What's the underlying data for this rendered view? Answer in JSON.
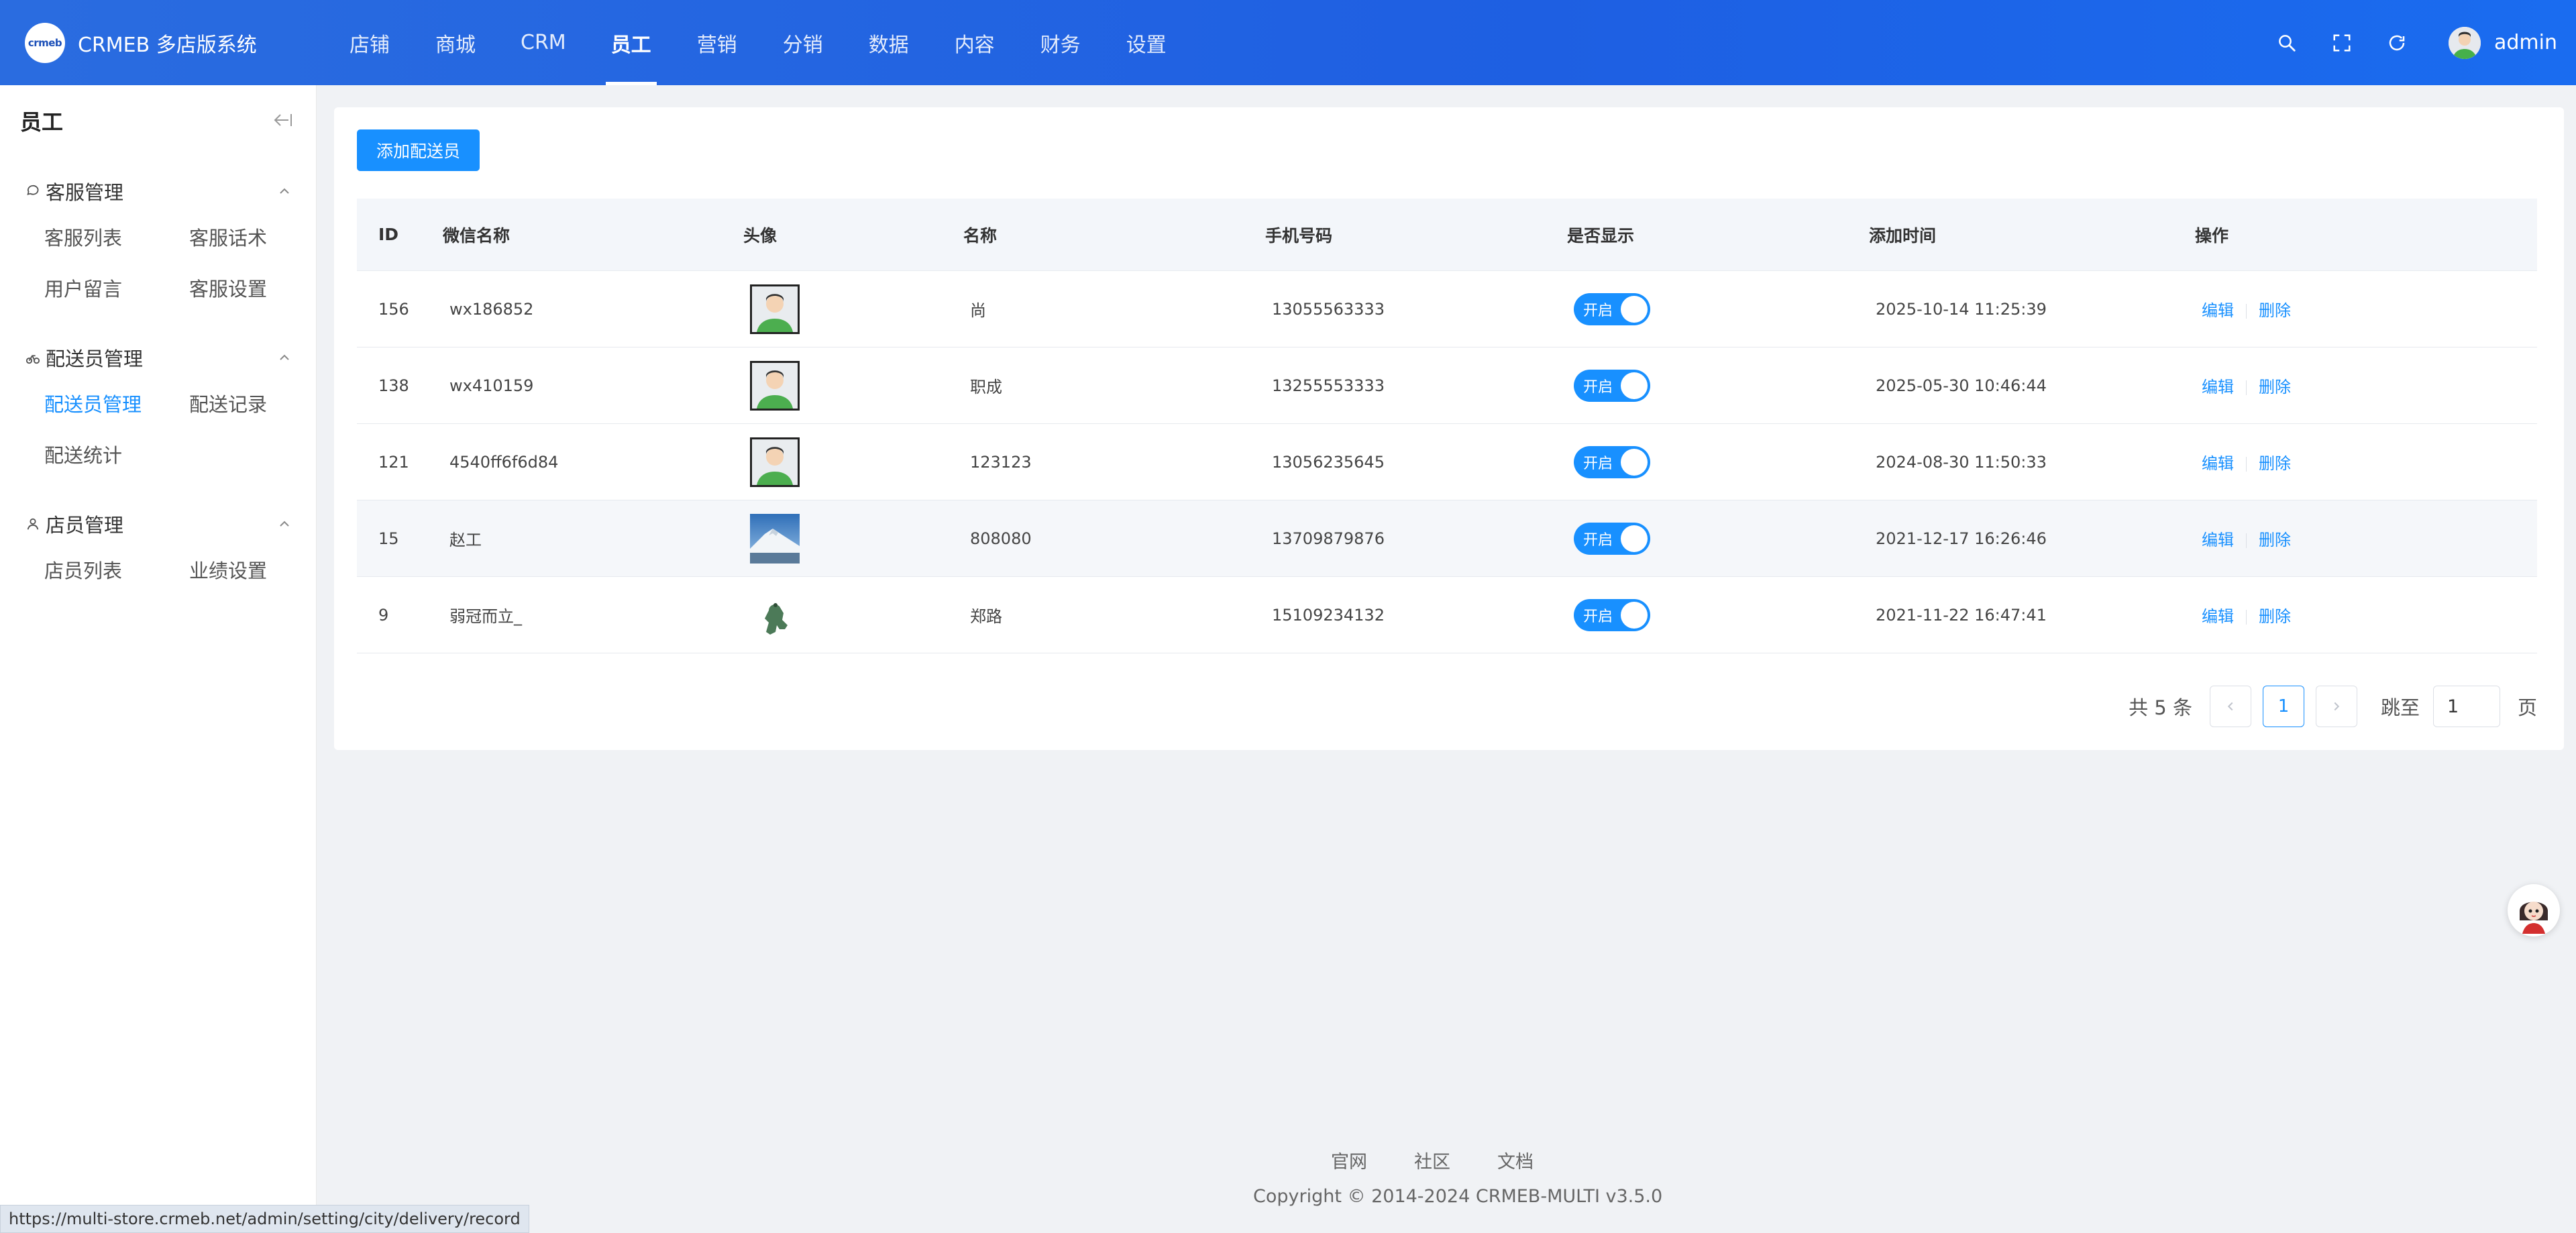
{
  "brand": {
    "logo_text": "crmeb",
    "name": "CRMEB 多店版系统"
  },
  "top_nav": [
    {
      "label": "店铺",
      "active": false
    },
    {
      "label": "商城",
      "active": false
    },
    {
      "label": "CRM",
      "active": false
    },
    {
      "label": "员工",
      "active": true
    },
    {
      "label": "营销",
      "active": false
    },
    {
      "label": "分销",
      "active": false
    },
    {
      "label": "数据",
      "active": false
    },
    {
      "label": "内容",
      "active": false
    },
    {
      "label": "财务",
      "active": false
    },
    {
      "label": "设置",
      "active": false
    }
  ],
  "header_right": {
    "icons": [
      "search-icon",
      "fullscreen-icon",
      "refresh-icon"
    ],
    "user": "admin"
  },
  "sidebar": {
    "title": "员工",
    "groups": [
      {
        "label": "客服管理",
        "icon": "chat-icon",
        "items": [
          "客服列表",
          "客服话术",
          "用户留言",
          "客服设置"
        ]
      },
      {
        "label": "配送员管理",
        "icon": "bike-icon",
        "items": [
          "配送员管理",
          "配送记录",
          "配送统计"
        ],
        "active_item": "配送员管理"
      },
      {
        "label": "店员管理",
        "icon": "person-icon",
        "items": [
          "店员列表",
          "业绩设置"
        ]
      }
    ]
  },
  "main": {
    "add_button": "添加配送员",
    "columns": [
      "ID",
      "微信名称",
      "头像",
      "名称",
      "手机号码",
      "是否显示",
      "添加时间",
      "操作"
    ],
    "rows": [
      {
        "id": "156",
        "wx": "wx186852",
        "avatar": "default-avatar",
        "name": "尚",
        "phone": "13055563333",
        "show": "开启",
        "time": "2025-10-14 11:25:39"
      },
      {
        "id": "138",
        "wx": "wx410159",
        "avatar": "default-avatar",
        "name": "职成",
        "phone": "13255553333",
        "show": "开启",
        "time": "2025-05-30 10:46:44"
      },
      {
        "id": "121",
        "wx": "4540ff6f6d84",
        "avatar": "default-avatar",
        "name": "123123",
        "phone": "13056235645",
        "show": "开启",
        "time": "2024-08-30 11:50:33"
      },
      {
        "id": "15",
        "wx": "赵工",
        "avatar": "mountain-photo",
        "name": "808080",
        "phone": "13709879876",
        "show": "开启",
        "time": "2021-12-17 16:26:46"
      },
      {
        "id": "9",
        "wx": "弱冠而立_",
        "avatar": "green-figure",
        "name": "郑路",
        "phone": "15109234132",
        "show": "开启",
        "time": "2021-11-22 16:47:41"
      }
    ],
    "op_edit": "编辑",
    "op_delete": "删除",
    "pagination": {
      "total": "共 5 条",
      "current": "1",
      "jump_label": "跳至",
      "jump_value": "1",
      "page_label": "页"
    }
  },
  "footer": {
    "links": [
      "官网",
      "社区",
      "文档"
    ],
    "copyright": "Copyright © 2014-2024 CRMEB-MULTI v3.5.0"
  },
  "status_url": "https://multi-store.crmeb.net/admin/setting/city/delivery/record",
  "colors": {
    "header": "#1e5fe2",
    "accent": "#1890ff",
    "background": "#f0f2f5"
  }
}
